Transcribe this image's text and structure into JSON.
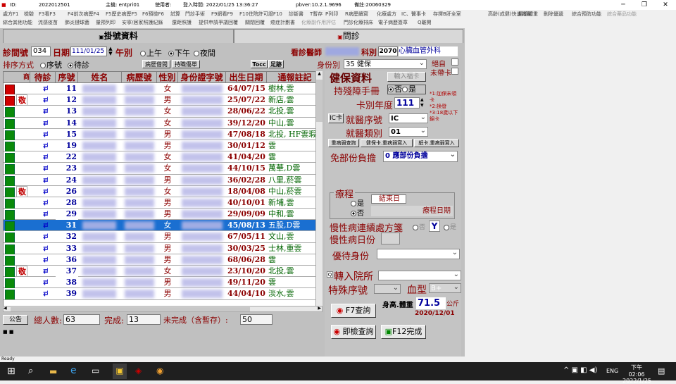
{
  "titlebar": {
    "id_label": "ID:",
    "clinic_code": "2022012501",
    "host": "主機: entpri01",
    "user_label": "使用者:",
    "login_time": "登入時間: 2022/01/25 13:36:27",
    "version": "pbver:10.2.1.9696",
    "spare": "備註:20060329"
  },
  "menu1": [
    "處方F1",
    "檢驗",
    "F3看F3",
    "F4前次病歷F4",
    "F5歷史病歷F5",
    "F6預檢F6",
    "試算",
    "門診手術",
    "F9網看F9",
    "F10住院許可證F10",
    "診斷書",
    "T暫存",
    "P列印",
    "R病歷續寫",
    "化療處方",
    "IC、醫事卡",
    "存擇B肝全室",
    "高齡(成健)快速問案",
    "惡檢體重",
    "刪除優遞",
    "綜合預防功能",
    "綜合藥品功能"
  ],
  "menu2": [
    "綜合其他功能",
    "流感疫苗",
    "肺炎鏈球菌",
    "量預列印",
    "安寧/居家照護紀錄",
    "還距照護",
    "提供申請爭議回覆",
    "關閉回覆",
    "癌症計劃書",
    "化療副作用評估",
    "門診化療排床",
    "電子病歷簽章",
    "Q離開"
  ],
  "tabs": {
    "schedule": "掛號資料",
    "consult": "問診"
  },
  "form": {
    "visit_no_label": "診間號",
    "visit_no": "034",
    "date_label": "日期",
    "date": "111/01/25",
    "shift_label": "午別",
    "shift_am": "上午",
    "shift_pm": "下午",
    "shift_night": "夜間",
    "doctor_label": "看診醫師",
    "dept_label": "科別",
    "dept_code": "2070",
    "dept_name": "心臟血管外科",
    "sort_label": "排序方式",
    "sort_seq": "序號",
    "sort_wait": "待診",
    "btn_history": "病歷借閱",
    "btn_sick": "持職傷單",
    "btn_tocc": "Tocc",
    "btn_foot": "足跡",
    "identity_label": "身份別",
    "identity_code": "35",
    "identity_name": "健保"
  },
  "grid": {
    "headers": [
      "商",
      "待診",
      "序號",
      "姓名",
      "病歷號",
      "性別",
      "身份證字號",
      "出生日期",
      "通報註記"
    ],
    "rows": [
      {
        "status": "red",
        "flag": "",
        "num": "11",
        "sex": "女",
        "dob": "64/07/15",
        "note": "樹林,雲"
      },
      {
        "status": "red",
        "flag": "敬",
        "num": "12",
        "sex": "男",
        "dob": "25/07/22",
        "note": "新店,雲"
      },
      {
        "status": "green",
        "flag": "",
        "num": "13",
        "sex": "女",
        "dob": "28/06/22",
        "note": "北投,雲"
      },
      {
        "status": "green",
        "flag": "",
        "num": "14",
        "sex": "女",
        "dob": "39/12/20",
        "note": "中山,雲"
      },
      {
        "status": "green",
        "flag": "",
        "num": "15",
        "sex": "男",
        "dob": "47/08/18",
        "note": "北投, HF雲瑕"
      },
      {
        "status": "green",
        "flag": "",
        "num": "19",
        "sex": "男",
        "dob": "30/01/12",
        "note": "雲"
      },
      {
        "status": "green",
        "flag": "",
        "num": "22",
        "sex": "女",
        "dob": "41/04/20",
        "note": "雲"
      },
      {
        "status": "green",
        "flag": "",
        "num": "23",
        "sex": "女",
        "dob": "44/10/15",
        "note": "萬華,D雲"
      },
      {
        "status": "green",
        "flag": "",
        "num": "24",
        "sex": "男",
        "dob": "36/02/28",
        "note": "八里,菸雲"
      },
      {
        "status": "green",
        "flag": "敬",
        "num": "26",
        "sex": "女",
        "dob": "18/04/08",
        "note": "中山,菸雲"
      },
      {
        "status": "green",
        "flag": "",
        "num": "28",
        "sex": "男",
        "dob": "40/10/01",
        "note": "新埔,雲"
      },
      {
        "status": "green",
        "flag": "",
        "num": "29",
        "sex": "男",
        "dob": "29/09/09",
        "note": "中和,雲"
      },
      {
        "status": "green",
        "flag": "",
        "num": "31",
        "sex": "女",
        "dob": "45/08/13",
        "note": "五股,D雲"
      },
      {
        "status": "green",
        "flag": "",
        "num": "32",
        "sex": "男",
        "dob": "67/05/11",
        "note": "文山,雲"
      },
      {
        "status": "green",
        "flag": "",
        "num": "33",
        "sex": "男",
        "dob": "30/03/25",
        "note": "士林,重雲"
      },
      {
        "status": "green",
        "flag": "",
        "num": "36",
        "sex": "男",
        "dob": "68/06/28",
        "note": "雲"
      },
      {
        "status": "green",
        "flag": "敬",
        "num": "37",
        "sex": "女",
        "dob": "23/10/20",
        "note": "北投,雲"
      },
      {
        "status": "green",
        "flag": "",
        "num": "38",
        "sex": "男",
        "dob": "49/11/20",
        "note": "雲"
      },
      {
        "status": "green",
        "flag": "",
        "num": "39",
        "sex": "男",
        "dob": "44/04/10",
        "note": "淡水,雲"
      }
    ]
  },
  "summary": {
    "btn": "公告",
    "total_label": "總人數:",
    "total": "63",
    "done_label": "完成:",
    "done": "13",
    "pending_label": "未完成（含暫存）:",
    "pending": "50"
  },
  "insurance": {
    "title": "健保資料",
    "input_card": "輸入福卡",
    "cert_label": "絕自",
    "card_label": "未帶卡",
    "disability_label": "持殘障手冊",
    "no": "否",
    "yes": "是",
    "card_year_label": "卡別年度",
    "card_year": "111",
    "note1": "*1:加保未領卡",
    "note2": "*2:換發",
    "note3": "*3:18歲以下錦卡",
    "ic_btn": "IC卡",
    "visit_seq_label": "就醫序號",
    "visit_seq": "IC",
    "visit_type_label": "就醫類別",
    "visit_type": "01",
    "btn_query": "重病弱查詢",
    "btn_write": "健保卡.重病弱寫入",
    "btn_paper": "紙卡.重病弱寫入",
    "copay_label": "免部份負擔",
    "copay_value": "0  應部份負擔",
    "course_label": "療程",
    "course_yes": "是",
    "course_no": "否",
    "course_end": "結束日",
    "course_date": "療程日期",
    "chronic_label": "慢性病連續處方箋",
    "chronic_no": "否",
    "chronic_y": "Y",
    "chronic_yes": "是",
    "chronic_day_label": "慢性病日份",
    "priority_label": "優待身份",
    "transfer_label": "轉入院所",
    "special_label": "特殊序號",
    "blood_label": "血型",
    "blood_value": "B+",
    "btn_f7": "F7查詢",
    "height_label": "身高.體重",
    "height_value": "71.5",
    "height_unit": "公斤",
    "height_date": "2020/12/01",
    "btn_query2": "即檢查詢",
    "btn_f12": "F12完成"
  },
  "statusbar": "Ready",
  "taskbar": {
    "lang": "ENG",
    "time": "下午 02:06",
    "date": "2022/1/25"
  }
}
